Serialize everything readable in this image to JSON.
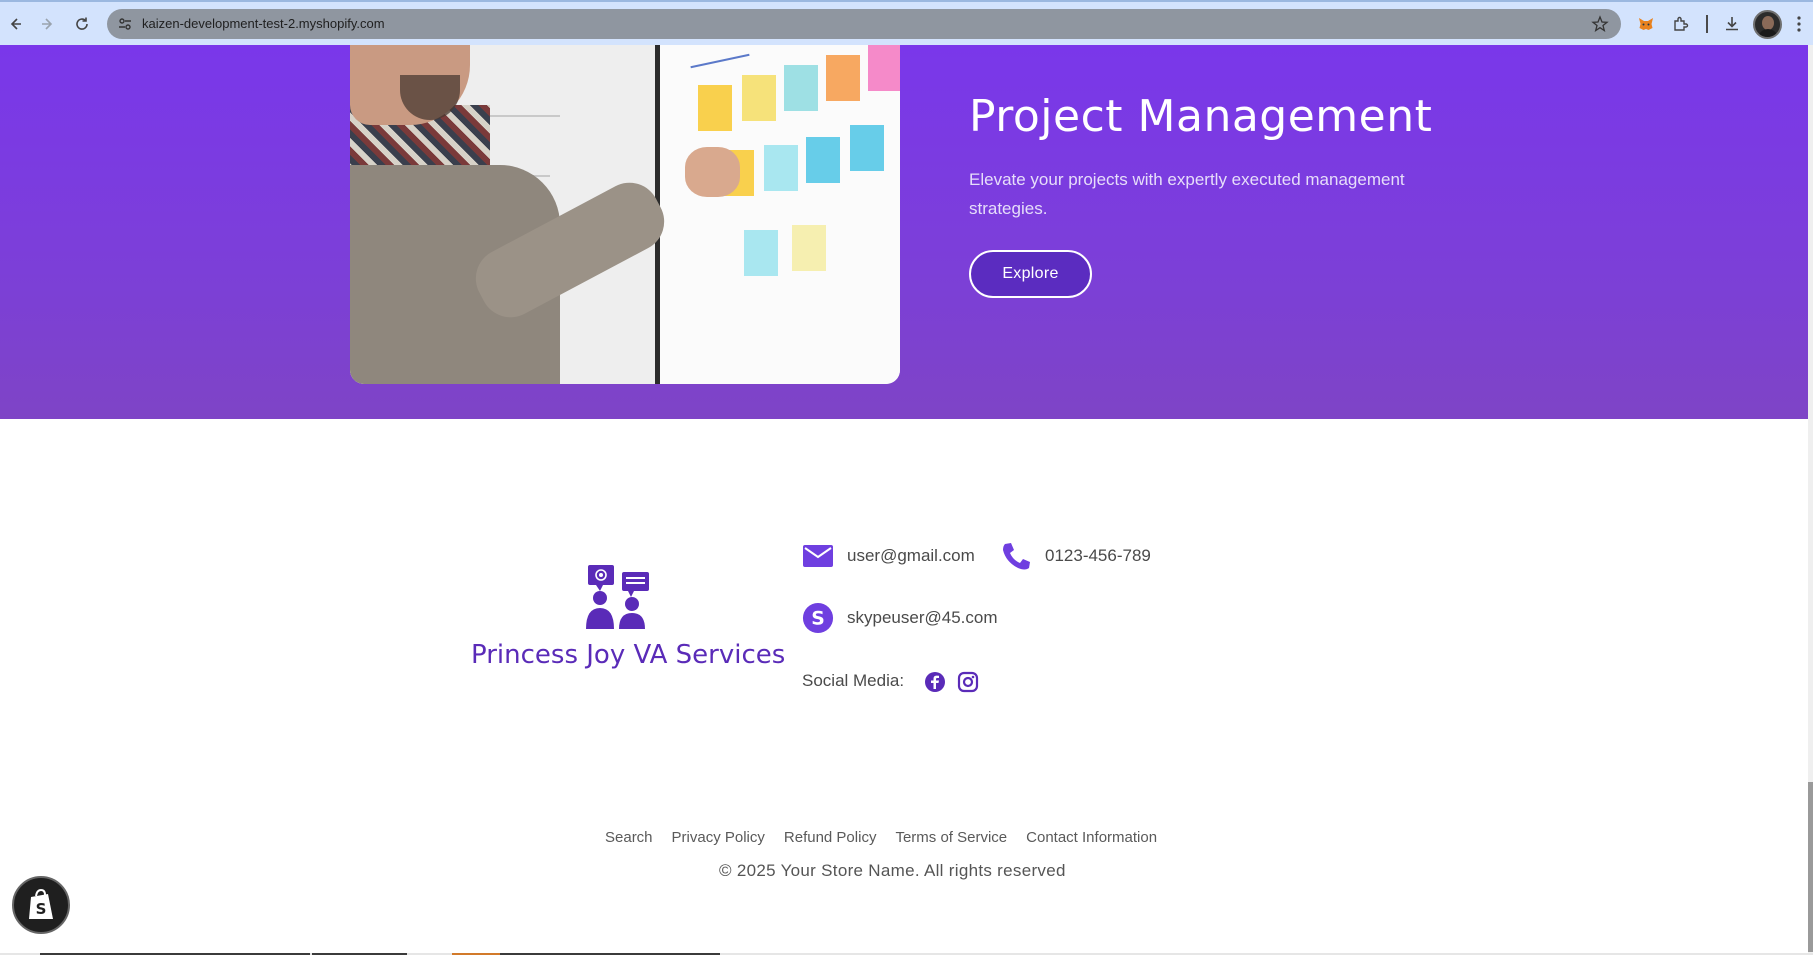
{
  "browser": {
    "url": "kaizen-development-test-2.myshopify.com",
    "back_icon": "arrow-left-icon",
    "forward_icon": "arrow-right-icon",
    "reload_icon": "reload-icon",
    "bookmark_icon": "star-icon"
  },
  "hero": {
    "title": "Project Management",
    "description": "Elevate your projects with expertly executed management strategies.",
    "button_label": "Explore",
    "image_icon": "planning-board-photo"
  },
  "footer": {
    "brand_name": "Princess Joy VA Services",
    "email": "user@gmail.com",
    "phone": "0123-456-789",
    "skype": "skypeuser@45.com",
    "social_label": "Social Media:",
    "links": [
      "Search",
      "Privacy Policy",
      "Refund Policy",
      "Terms of Service",
      "Contact Information"
    ],
    "copyright": "© 2025 Your Store Name. All rights reserved"
  },
  "colors": {
    "hero_top": "#7a37ea",
    "hero_bottom": "#7e44c6",
    "brand": "#5a2bb8",
    "button_bg": "#5b2cc0",
    "icon_accent": "#6f3fe0"
  }
}
